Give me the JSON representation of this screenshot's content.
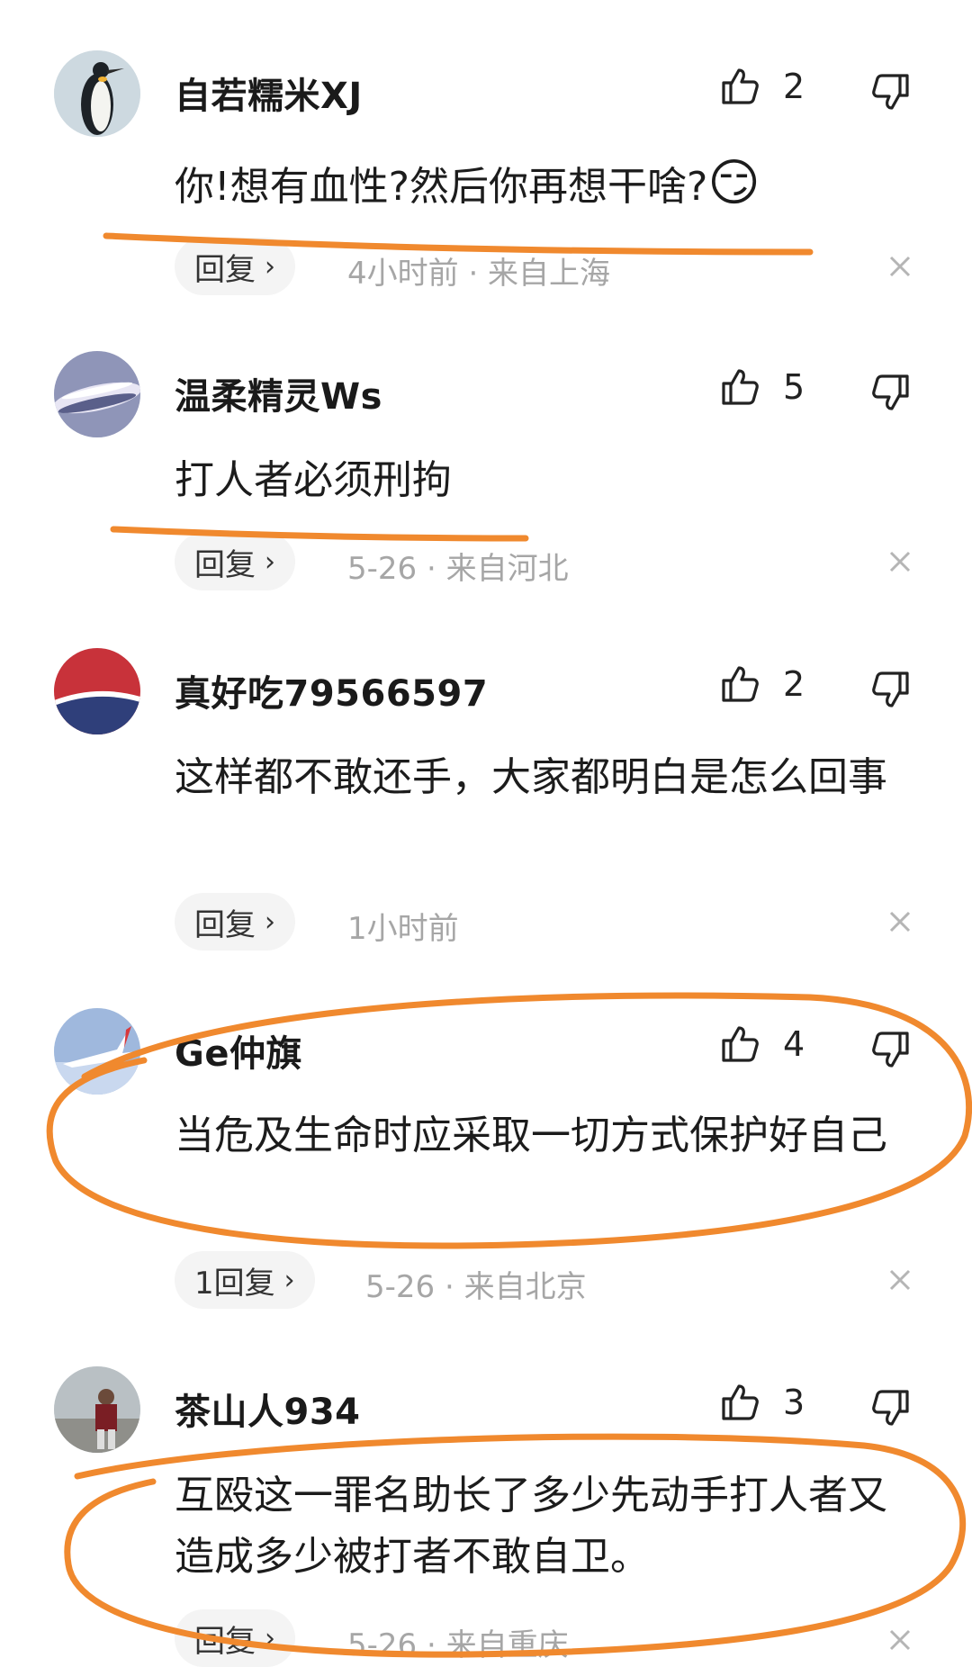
{
  "comments": [
    {
      "username": "自若糯米XJ",
      "likes": "2",
      "content": "你!想有血性?然后你再想干啥?",
      "emoji": "😏",
      "reply_label": "回复",
      "meta": "4小时前 · 来自上海"
    },
    {
      "username": "温柔精灵Ws",
      "likes": "5",
      "content": "打人者必须刑拘",
      "reply_label": "回复",
      "meta": "5-26 · 来自河北"
    },
    {
      "username": "真好吃79566597",
      "likes": "2",
      "content": "这样都不敢还手，大家都明白是怎么回事",
      "reply_label": "回复",
      "meta": "1小时前"
    },
    {
      "username": "Ge仲旗",
      "likes": "4",
      "content": "当危及生命时应采取一切方式保护好自己",
      "reply_label": "1回复",
      "meta": "5-26 · 来自北京"
    },
    {
      "username": "茶山人934",
      "likes": "3",
      "content": "互殴这一罪名助长了多少先动手打人者又造成多少被打者不敢自卫。",
      "reply_label": "回复",
      "meta": "5-26 · 来自重庆"
    }
  ],
  "colors": {
    "annotation": "#f0892e",
    "meta_gray": "#a6a6a6",
    "reply_bg": "#f4f4f4"
  },
  "icons": {
    "like": "thumbs-up-icon",
    "dislike": "thumbs-down-icon",
    "close": "close-icon",
    "reply_chevron": "chevron-right-icon"
  }
}
